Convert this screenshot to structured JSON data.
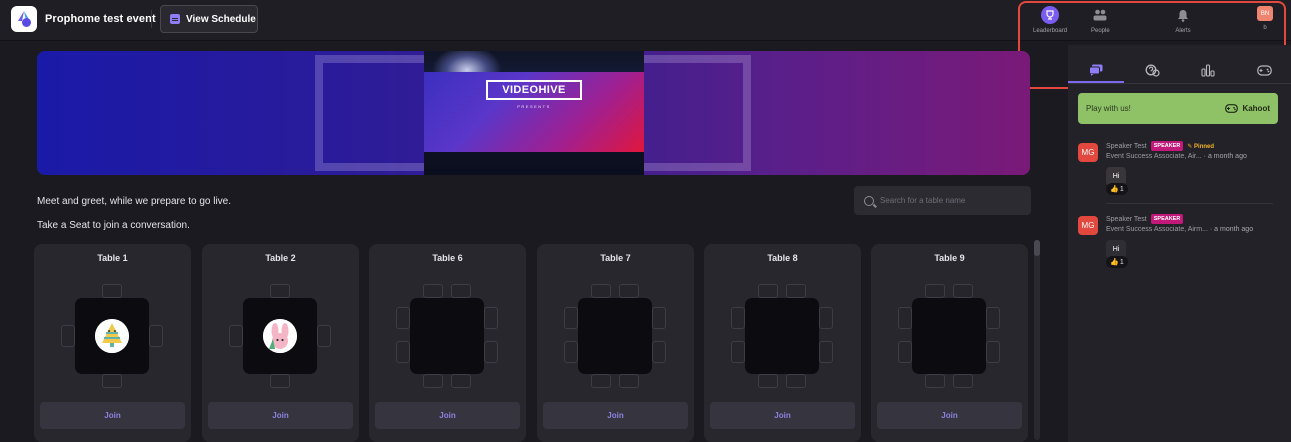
{
  "header": {
    "event_title": "Prophome test event",
    "schedule_label": "View Schedule",
    "nav": [
      {
        "id": "leaderboard",
        "label": "Leaderboard",
        "icon": "trophy-icon"
      },
      {
        "id": "people",
        "label": "People",
        "icon": "people-icon"
      },
      {
        "id": "alerts",
        "label": "Alerts",
        "icon": "bell-icon"
      },
      {
        "id": "profile",
        "label": "b",
        "avatar_initials": "BN"
      }
    ]
  },
  "banner": {
    "video_title": "VIDEOHIVE",
    "video_subtitle": "PRESENTS"
  },
  "main": {
    "intro_line1": "Meet and greet, while we prepare to go live.",
    "intro_line2": "Take a Seat to join a conversation.",
    "search_placeholder": "Search for a table name",
    "join_label": "Join",
    "tables": [
      {
        "name": "Table 1",
        "occupied": true,
        "avatar": "yellow-tree-avatar"
      },
      {
        "name": "Table 2",
        "occupied": true,
        "avatar": "bunny-avatar"
      },
      {
        "name": "Table 6",
        "occupied": false
      },
      {
        "name": "Table 7",
        "occupied": false
      },
      {
        "name": "Table 8",
        "occupied": false
      },
      {
        "name": "Table 9",
        "occupied": false
      }
    ]
  },
  "side": {
    "tabs": [
      "chat-icon",
      "qa-icon",
      "polls-icon",
      "games-icon"
    ],
    "active_tab": "chat-icon",
    "kahoot_text": "Play with us!",
    "kahoot_brand": "Kahoot",
    "messages": [
      {
        "initials": "MG",
        "name": "Speaker Test",
        "badge": "SPEAKER",
        "pinned": "Pinned",
        "title": "Event Success Associate, Air...",
        "time": "· a month ago",
        "text": "Hi",
        "reaction": "👍",
        "reaction_count": "1"
      },
      {
        "initials": "MG",
        "name": "Speaker Test",
        "badge": "SPEAKER",
        "pinned": "",
        "title": "Event Success Associate, Airm...",
        "time": "· a month ago",
        "text": "Hi",
        "reaction": "👍",
        "reaction_count": "1"
      }
    ]
  },
  "colors": {
    "accent": "#7b5cf0",
    "highlight_box": "#e2483d",
    "speaker_badge": "#c2187a",
    "kahoot_green": "#8fc167",
    "avatar_red": "#e2483d"
  }
}
